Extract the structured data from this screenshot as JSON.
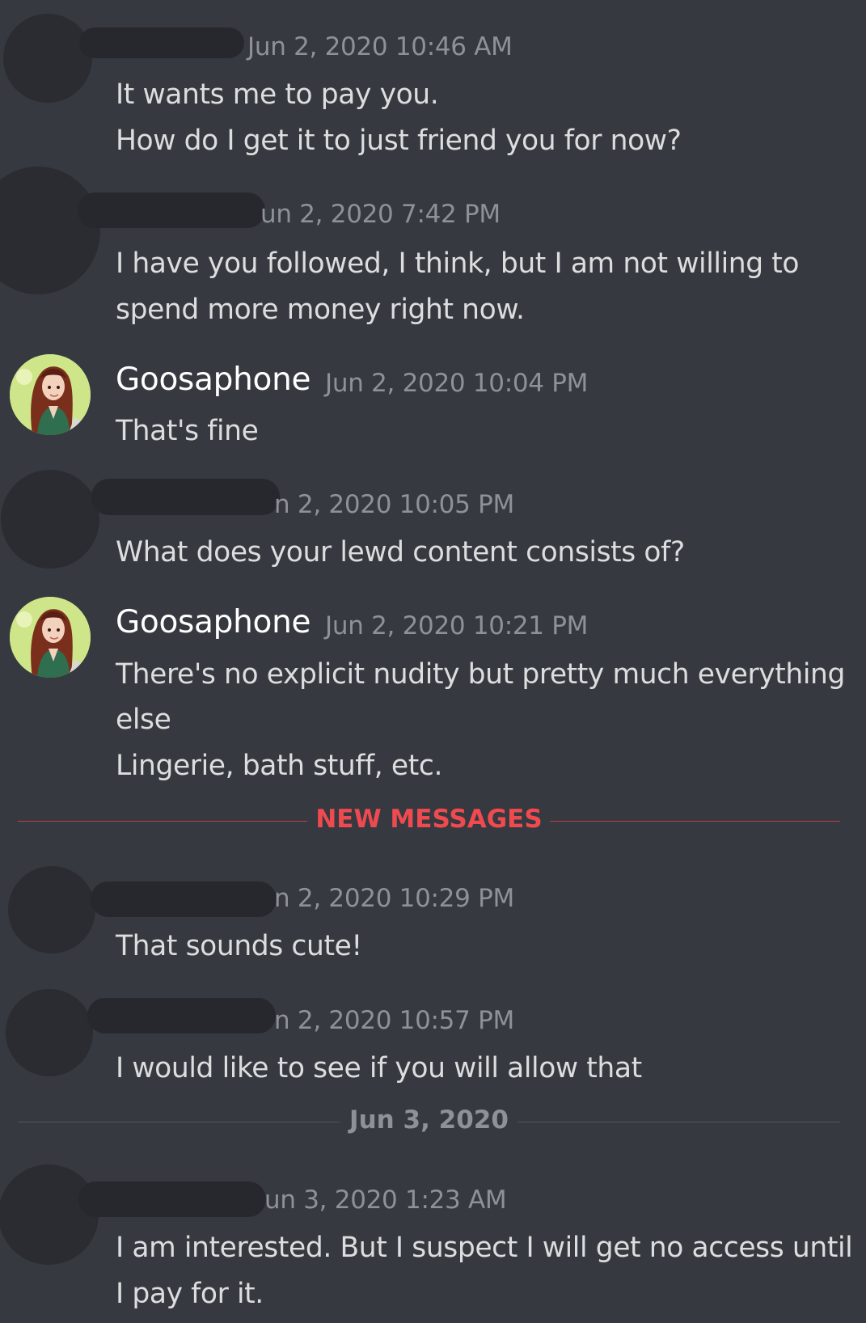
{
  "messages": [
    {
      "author": "",
      "timestamp": "Jun 2, 2020 10:46 AM",
      "lines": [
        "It wants me to pay you.",
        "How do I get it to just friend you for now?"
      ]
    },
    {
      "author": "",
      "timestamp": "un 2, 2020 7:42 PM",
      "lines": [
        "I have you followed, I think, but I am not willing to",
        "spend more money right now."
      ]
    },
    {
      "author": "Goosaphone",
      "timestamp": "Jun 2, 2020 10:04 PM",
      "lines": [
        "That's fine"
      ]
    },
    {
      "author": "",
      "timestamp": "n 2, 2020 10:05 PM",
      "lines": [
        "What does your lewd content consists of?"
      ]
    },
    {
      "author": "Goosaphone",
      "timestamp": "Jun 2, 2020 10:21 PM",
      "lines": [
        "There's no explicit nudity but pretty much everything",
        "else",
        "Lingerie, bath stuff, etc."
      ]
    },
    {
      "author": "",
      "timestamp": "n 2, 2020 10:29 PM",
      "lines": [
        "That sounds cute!"
      ]
    },
    {
      "author": "",
      "timestamp": "n 2, 2020 10:57 PM",
      "lines": [
        "I would like to see if you will allow that"
      ]
    },
    {
      "author": "",
      "timestamp": "un 3, 2020 1:23 AM",
      "lines": [
        "I am interested. But I suspect I will get no access until",
        "I pay for it."
      ]
    }
  ],
  "dividers": {
    "new_messages": "NEW MESSAGES",
    "date": "Jun 3, 2020"
  },
  "colors": {
    "background": "#36393f",
    "text": "#dcddde",
    "timestamp": "#8e9297",
    "username": "#ffffff",
    "new_messages_accent": "#ef4a50",
    "redaction": "#26282d"
  },
  "icons": {
    "goosaphone_avatar": "anime-girl-avatar-icon"
  }
}
